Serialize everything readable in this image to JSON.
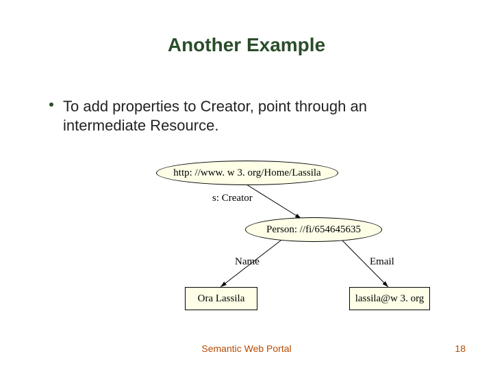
{
  "title": "Another Example",
  "bullet_text": "To add properties to Creator, point through an intermediate Resource.",
  "diagram": {
    "node1": "http: //www. w 3. org/Home/Lassila",
    "edge1": "s: Creator",
    "node2": "Person: //fi/654645635",
    "edge2": "Name",
    "edge3": "Email",
    "node3": "Ora Lassila",
    "node4": "lassila@w 3. org"
  },
  "footer": "Semantic Web Portal",
  "page": "18"
}
